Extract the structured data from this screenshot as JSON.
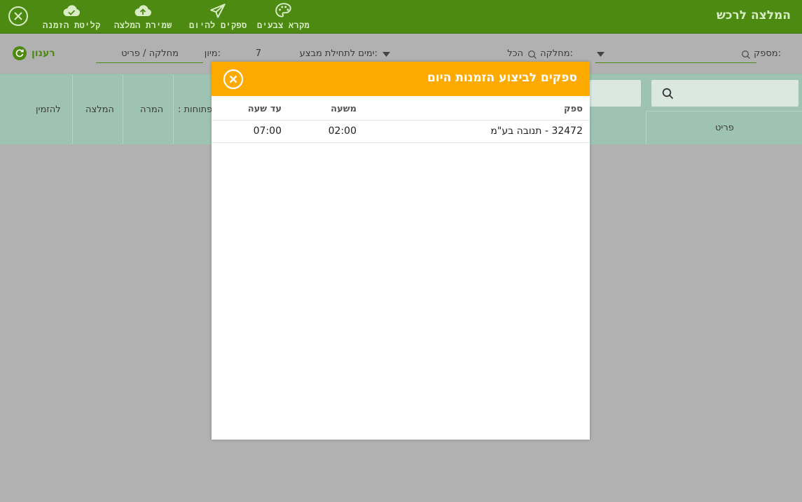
{
  "app": {
    "title": "המלצה לרכש"
  },
  "toolbar": {
    "palette_label": "מקרא צבעים",
    "suppliers_today_label": "ספקים להיום",
    "save_recommendation_label": "שמירת המלצה",
    "order_intake_label": "קליטת הזמנה"
  },
  "filters": {
    "supplier_label": "מספק:",
    "department_label": "מחלקה:",
    "department_value": "הכל",
    "days_label": "ימים לתחילת מבצע:",
    "days_value": "7",
    "sort_label": "מיון:",
    "sort_value": "מחלקה / פריט",
    "refresh_label": "רענון"
  },
  "table": {
    "headers": {
      "item": "פריט",
      "open": ": פתוחות",
      "conversion": "המרה",
      "recommendation": "המלצה",
      "to_order": "להזמין"
    }
  },
  "modal": {
    "title": "ספקים לביצוע הזמנות היום",
    "columns": {
      "supplier": "ספק",
      "from_hour": "משעה",
      "to_hour": "עד שעה"
    },
    "rows": [
      {
        "supplier": "32472 - תנובה בע\"מ",
        "from_hour": "02:00",
        "to_hour": "07:00"
      }
    ]
  },
  "colors": {
    "topbar": "#4c8a12",
    "modal_header": "#ffaa00",
    "table_header": "#9ec3b3",
    "overlay": "#b1b1b1"
  }
}
